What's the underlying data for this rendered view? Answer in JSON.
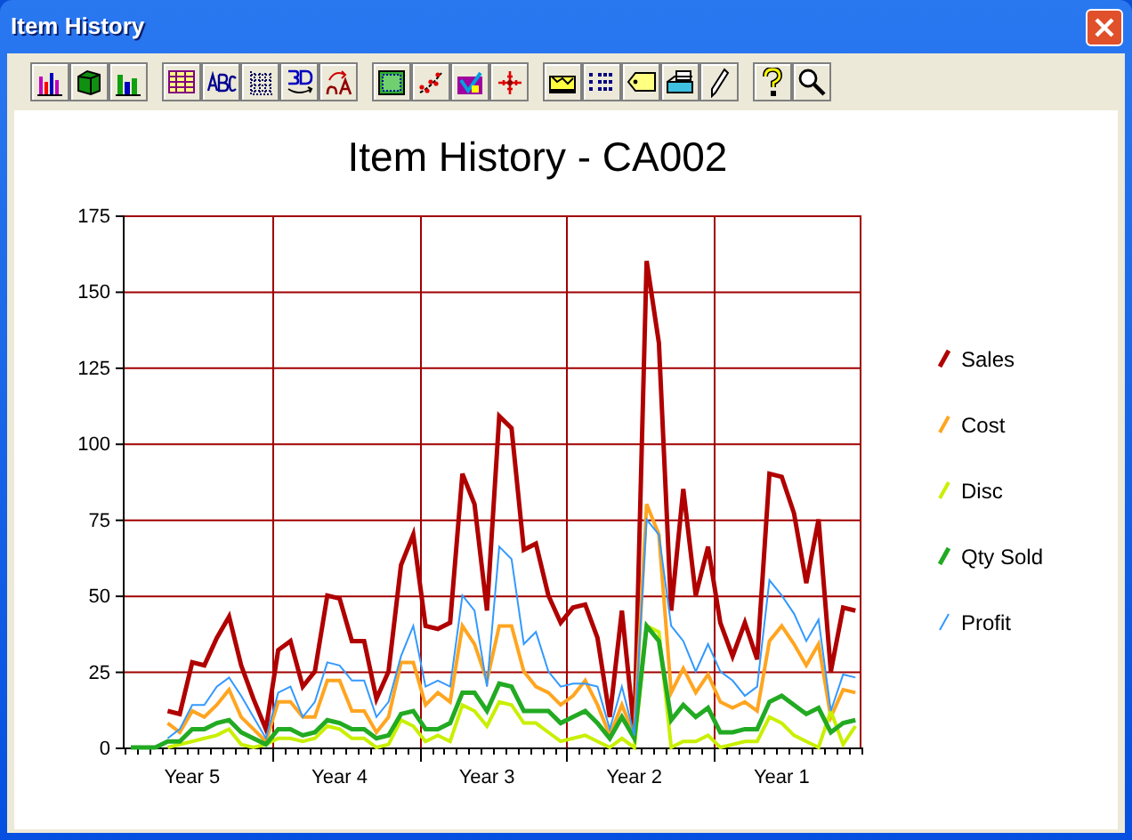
{
  "window": {
    "title": "Item History"
  },
  "chart": {
    "chart_data": {
      "type": "line",
      "title": "Item History - CA002",
      "categories": [
        null,
        null,
        null,
        null,
        null,
        "Year 5",
        null,
        null,
        null,
        null,
        null,
        null,
        null,
        null,
        null,
        null,
        null,
        "Year 4",
        null,
        null,
        null,
        null,
        null,
        null,
        null,
        null,
        null,
        null,
        null,
        "Year 3",
        null,
        null,
        null,
        null,
        null,
        null,
        null,
        null,
        null,
        null,
        null,
        "Year 2",
        null,
        null,
        null,
        null,
        null,
        null,
        null,
        null,
        null,
        null,
        null,
        "Year 1",
        null,
        null,
        null,
        null,
        null,
        null
      ],
      "grid": {
        "x": true,
        "y": true
      },
      "legend": true,
      "ylim": [
        0,
        175
      ],
      "yticks": [
        0,
        25,
        50,
        75,
        100,
        125,
        150,
        175
      ],
      "series": [
        {
          "name": "Sales",
          "color": "#b00000",
          "values": [
            null,
            null,
            null,
            12,
            11,
            28,
            27,
            36,
            43,
            27,
            16,
            6,
            32,
            35,
            20,
            25,
            50,
            49,
            35,
            35,
            16,
            25,
            60,
            70,
            40,
            39,
            41,
            90,
            80,
            45,
            109,
            105,
            65,
            67,
            50,
            41,
            46,
            47,
            36,
            10,
            45,
            5,
            160,
            133,
            45,
            85,
            50,
            66,
            41,
            30,
            41,
            29,
            90,
            89,
            77,
            54,
            75,
            25,
            46,
            45
          ]
        },
        {
          "name": "Cost",
          "color": "#ffa520",
          "values": [
            null,
            null,
            null,
            8,
            5,
            12,
            10,
            14,
            19,
            10,
            6,
            2,
            15,
            15,
            10,
            10,
            22,
            22,
            12,
            12,
            5,
            10,
            28,
            28,
            14,
            18,
            15,
            40,
            34,
            22,
            40,
            40,
            25,
            20,
            18,
            14,
            17,
            22,
            14,
            4,
            14,
            4,
            80,
            70,
            18,
            26,
            18,
            24,
            15,
            13,
            15,
            12,
            35,
            40,
            34,
            27,
            34,
            10,
            19,
            18
          ]
        },
        {
          "name": "Disc",
          "color": "#c8f000",
          "values": [
            null,
            null,
            null,
            0,
            1,
            2,
            3,
            4,
            6,
            1,
            0,
            1,
            3,
            3,
            2,
            3,
            7,
            6,
            3,
            3,
            0,
            1,
            9,
            7,
            2,
            4,
            2,
            14,
            12,
            7,
            15,
            14,
            8,
            8,
            5,
            2,
            3,
            4,
            2,
            0,
            3,
            0,
            40,
            38,
            0,
            2,
            2,
            4,
            0,
            1,
            2,
            2,
            10,
            8,
            4,
            2,
            0,
            12,
            1,
            7
          ]
        },
        {
          "name": "Qty Sold",
          "color": "#22aa22",
          "values": [
            0,
            0,
            0,
            2,
            2,
            6,
            6,
            8,
            9,
            5,
            3,
            1,
            6,
            6,
            4,
            5,
            9,
            8,
            6,
            6,
            3,
            4,
            11,
            12,
            6,
            6,
            8,
            18,
            18,
            12,
            21,
            20,
            12,
            12,
            12,
            8,
            10,
            12,
            8,
            3,
            10,
            3,
            40,
            35,
            9,
            14,
            10,
            13,
            5,
            5,
            6,
            6,
            15,
            17,
            14,
            11,
            13,
            5,
            8,
            9
          ]
        },
        {
          "name": "Profit",
          "color": "#3399ff",
          "values": [
            null,
            null,
            null,
            3,
            6,
            14,
            14,
            20,
            23,
            17,
            10,
            3,
            18,
            20,
            10,
            15,
            28,
            27,
            22,
            22,
            10,
            15,
            30,
            40,
            20,
            22,
            20,
            50,
            45,
            20,
            66,
            62,
            34,
            38,
            25,
            20,
            21,
            21,
            20,
            6,
            20,
            4,
            75,
            70,
            40,
            35,
            25,
            34,
            25,
            22,
            17,
            20,
            55,
            50,
            44,
            35,
            42,
            12,
            24,
            23
          ]
        }
      ]
    }
  }
}
